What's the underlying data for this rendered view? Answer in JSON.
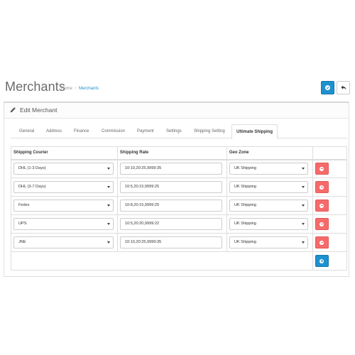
{
  "header": {
    "title": "Merchants",
    "breadcrumb": [
      {
        "label": "Home"
      },
      {
        "label": "Merchants"
      }
    ],
    "save_icon": "check-circle-icon",
    "back_icon": "reply-icon"
  },
  "panel": {
    "icon": "pencil-icon",
    "title": "Edit Merchant"
  },
  "tabs": [
    {
      "label": "General"
    },
    {
      "label": "Address"
    },
    {
      "label": "Finance"
    },
    {
      "label": "Commission"
    },
    {
      "label": "Payment"
    },
    {
      "label": "Settings"
    },
    {
      "label": "Shipping Setting"
    },
    {
      "label": "Ultimate Shipping",
      "active": true
    }
  ],
  "table": {
    "headers": [
      "Shipping Courier",
      "Shipping Rate",
      "Geo Zone"
    ],
    "rows": [
      {
        "courier": "DHL (1-3 Days)",
        "rate": "10:10,20:25,9999:35",
        "zone": "UK Shipping"
      },
      {
        "courier": "DHL (3-7 Days)",
        "rate": "10:5,20:15,9999:25",
        "zone": "UK Shipping"
      },
      {
        "courier": "Fedex",
        "rate": "10:8,20:15,9999:25",
        "zone": "UK Shipping"
      },
      {
        "courier": "UPS",
        "rate": "10:5,20:20,9999:22",
        "zone": "UK Shipping"
      },
      {
        "courier": "JNE",
        "rate": "10:10,20:25,9999:35",
        "zone": "UK Shipping"
      }
    ],
    "remove_icon": "minus-circle-icon",
    "add_icon": "plus-circle-icon"
  },
  "colors": {
    "primary": "#1e91cf",
    "danger": "#f56b6b"
  }
}
